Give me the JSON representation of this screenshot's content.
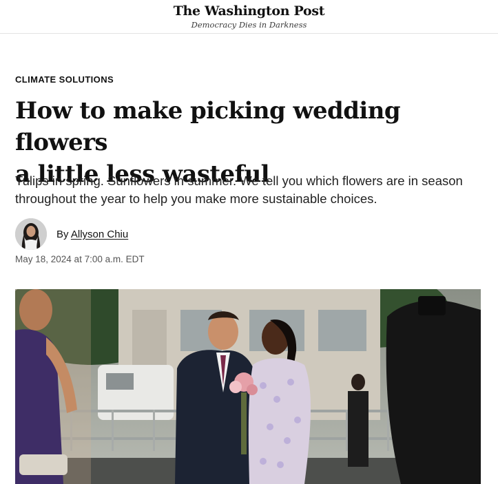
{
  "header": {
    "masthead": "The Washington Post",
    "tagline": "Democracy Dies in Darkness"
  },
  "article": {
    "kicker": "CLIMATE SOLUTIONS",
    "headline_line1": "How to make picking wedding flowers",
    "headline_line2": "a little less wasteful",
    "dek": "Tulips in spring. Sunflowers in summer. We tell you which flowers are in season throughout the year to help you make more sustainable choices.",
    "byline_prefix": "By",
    "author": "Allyson Chiu",
    "timestamp": "May 18, 2024 at 7:00 a.m. EDT"
  },
  "colors": {
    "text": "#111111",
    "muted": "#555555",
    "divider": "#e3e3e3"
  }
}
